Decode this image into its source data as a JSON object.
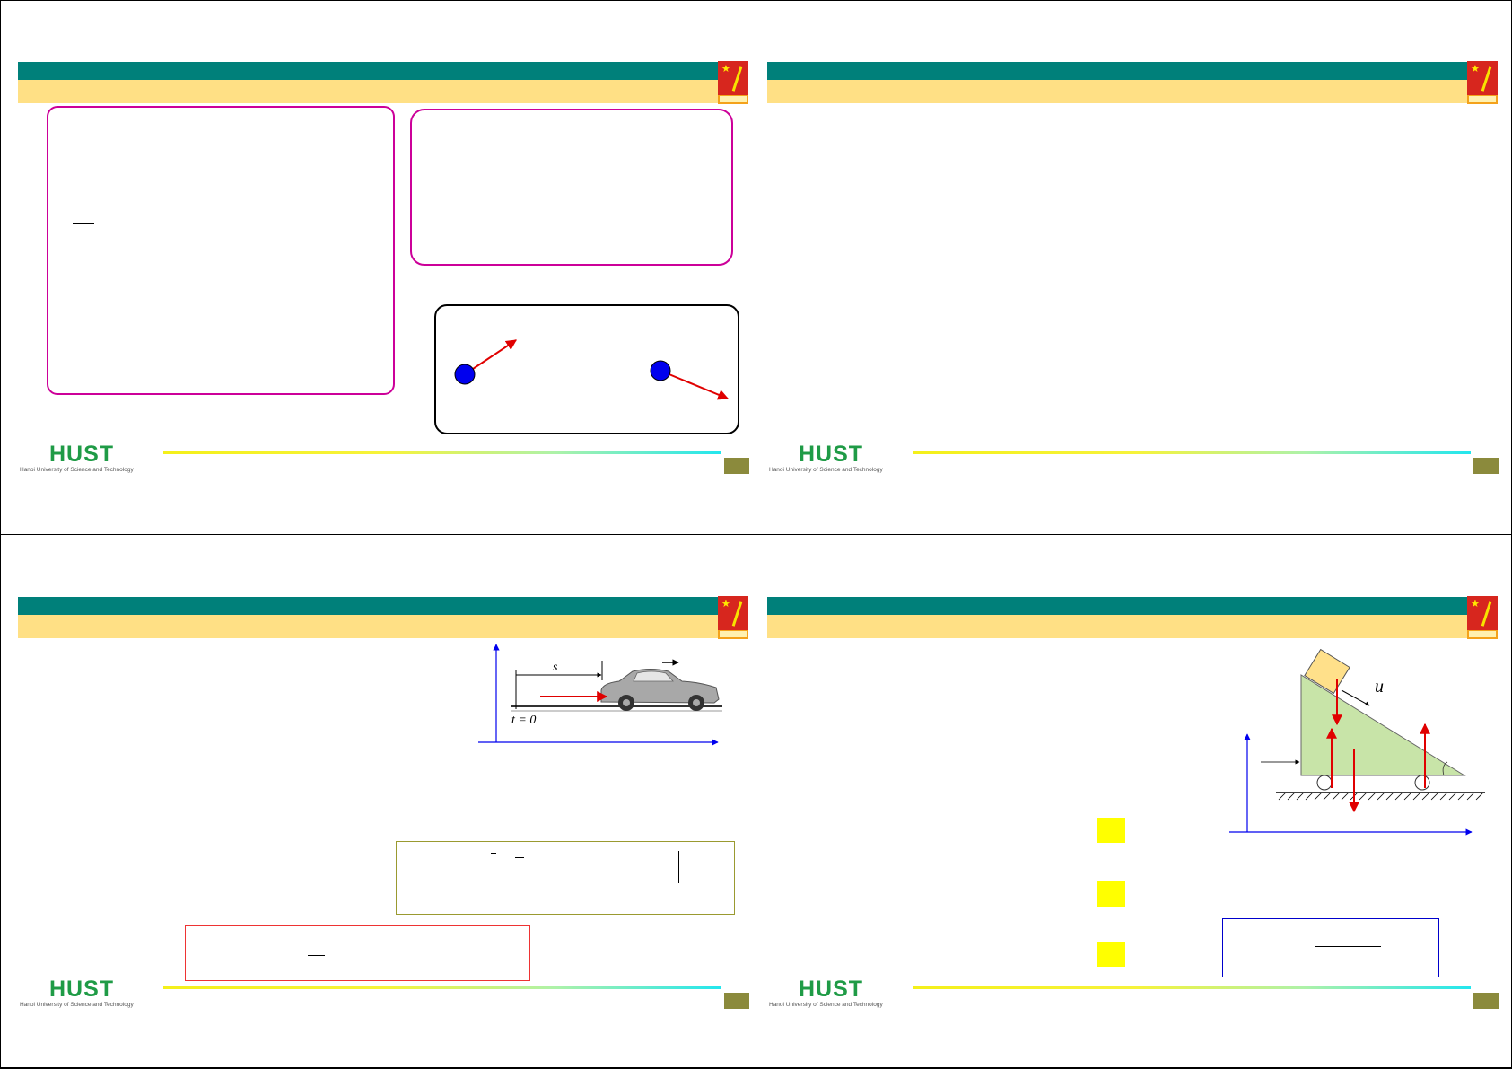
{
  "document": {
    "logo": {
      "word": "HUST",
      "subtitle": "Hanoi University of Science and Technology"
    },
    "colors": {
      "teal": "#00807a",
      "yellow": "#ffe085",
      "footer_box": "#8b8a3c",
      "magenta": "#cc0099",
      "vector": "#e00000",
      "particle": "#0000ee",
      "axis": "#0000ee",
      "wedge": "#c8e4a8",
      "block": "#ffe08a",
      "highlight": "#ffff00"
    },
    "slides": [
      {
        "id": 1,
        "content": "two magenta text frames; framed figure with two particles and velocity vectors"
      },
      {
        "id": 2,
        "content": "blank slide body"
      },
      {
        "id": 3,
        "content": "car on road with axes and displacement marker"
      },
      {
        "id": 4,
        "content": "block on inclined wedge with force vectors and axes"
      }
    ],
    "figure_labels": {
      "car_displacement": "s",
      "car_time": "t = 0",
      "wedge_velocity": "u"
    }
  }
}
